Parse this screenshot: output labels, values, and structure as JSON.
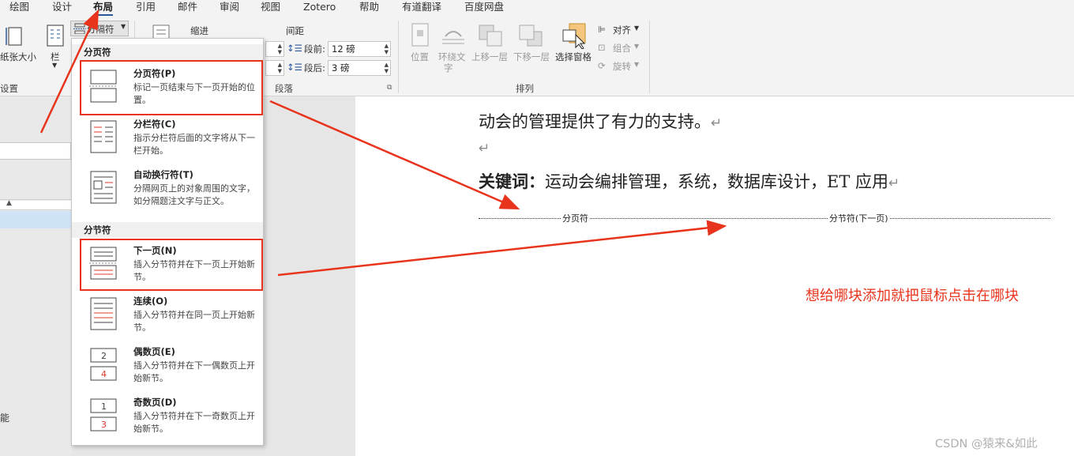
{
  "tabs": [
    "绘图",
    "设计",
    "布局",
    "引用",
    "邮件",
    "审阅",
    "视图",
    "Zotero",
    "帮助",
    "有道翻译",
    "百度网盘"
  ],
  "active_tab": "布局",
  "ribbon": {
    "breaks_button": "分隔符",
    "paper_size": "纸张大小",
    "columns": "栏",
    "page_setup_group": "设置",
    "indent_label": "缩进",
    "spacing_label": "间距",
    "before_label": "段前:",
    "before_value": "12 磅",
    "after_label": "段后:",
    "after_value": "3 磅",
    "paragraph_group": "段落",
    "position": "位置",
    "wrap_text_1": "环绕文",
    "wrap_text_2": "字",
    "bring_forward": "上移一层",
    "send_backward": "下移一层",
    "selection_pane": "选择窗格",
    "align": "对齐",
    "group": "组合",
    "rotate": "旋转",
    "arrange_group": "排列"
  },
  "left_pane": {
    "fragment": "能"
  },
  "menu": {
    "page_breaks_header": "分页符",
    "section_breaks_header": "分节符",
    "items": [
      {
        "title": "分页符(P)",
        "desc": "标记一页结束与下一页开始的位置。"
      },
      {
        "title": "分栏符(C)",
        "desc": "指示分栏符后面的文字将从下一栏开始。"
      },
      {
        "title": "自动换行符(T)",
        "desc": "分隔网页上的对象周围的文字，如分隔题注文字与正文。"
      },
      {
        "title": "下一页(N)",
        "desc": "插入分节符并在下一页上开始新节。"
      },
      {
        "title": "连续(O)",
        "desc": "插入分节符并在同一页上开始新节。"
      },
      {
        "title": "偶数页(E)",
        "desc": "插入分节符并在下一偶数页上开始新节。"
      },
      {
        "title": "奇数页(D)",
        "desc": "插入分节符并在下一奇数页上开始新节。"
      }
    ]
  },
  "document": {
    "line1": "动会的管理提供了有力的支持。",
    "keywords_label": "关键词：",
    "keywords": "运动会编排管理，系统，数据库设计，ET 应用",
    "page_break_label": "分页符",
    "section_break_label": "分节符(下一页)",
    "pilcrow": "↵"
  },
  "annotation": "想给哪块添加就把鼠标点击在哪块",
  "watermark": "CSDN @猿来&如此",
  "colors": {
    "accent": "#2b579a",
    "annotation_red": "#e8341c",
    "selected_row": "#cfe3f7"
  }
}
